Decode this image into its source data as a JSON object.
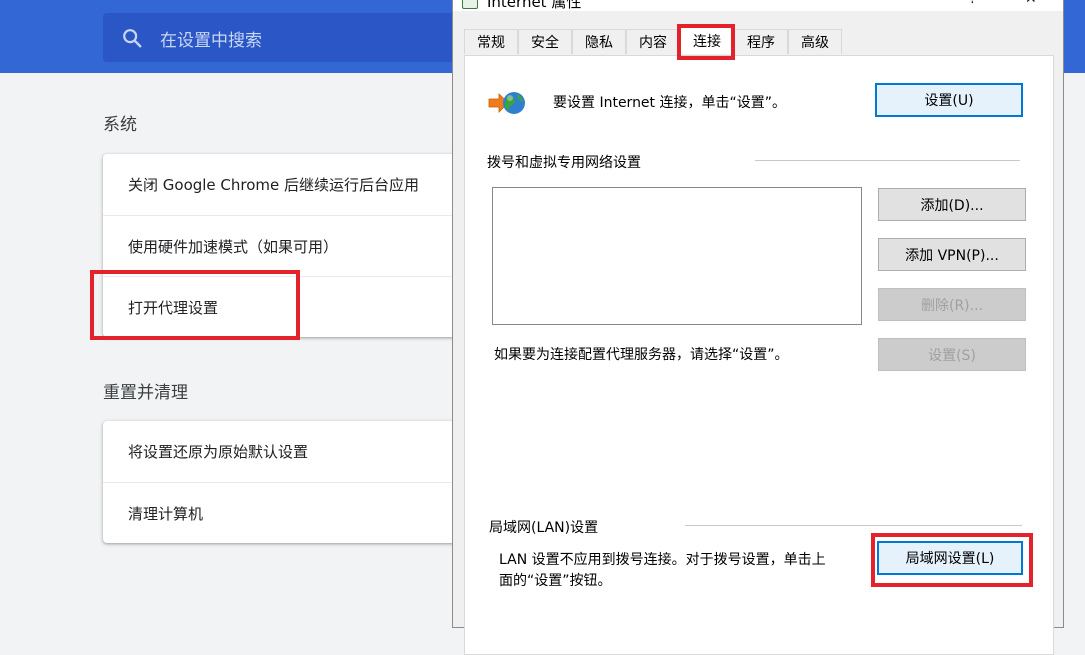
{
  "chrome": {
    "search": {
      "placeholder": "在设置中搜索",
      "icon": "search-icon"
    },
    "sections": [
      {
        "title": "系统",
        "items": [
          "关闭 Google Chrome 后继续运行后台应用",
          "使用硬件加速模式（如果可用）",
          "打开代理设置"
        ]
      },
      {
        "title": "重置并清理",
        "items": [
          "将设置还原为原始默认设置",
          "清理计算机"
        ]
      }
    ],
    "colors": {
      "header": "#3367d6",
      "search_bg": "#2a56c6",
      "highlight": "#e3222c"
    }
  },
  "dialog": {
    "title": "Internet 属性",
    "window_controls": [
      "?",
      "✕"
    ],
    "tabs": [
      "常规",
      "安全",
      "隐私",
      "内容",
      "连接",
      "程序",
      "高级"
    ],
    "active_tab": "连接",
    "setup_text": "要设置 Internet 连接，单击“设置”。",
    "setup_button": "设置(U)",
    "dialup_group_label": "拨号和虚拟专用网络设置",
    "add_button": "添加(D)...",
    "add_vpn_button": "添加 VPN(P)...",
    "remove_button": "删除(R)...",
    "proxy_hint": "如果要为连接配置代理服务器，请选择“设置”。",
    "settings_button": "设置(S)",
    "lan_group_label": "局域网(LAN)设置",
    "lan_text_line1": "LAN 设置不应用到拨号连接。对于拨号设置，单击上",
    "lan_text_line2": "面的“设置”按钮。",
    "lan_button": "局域网设置(L)"
  }
}
